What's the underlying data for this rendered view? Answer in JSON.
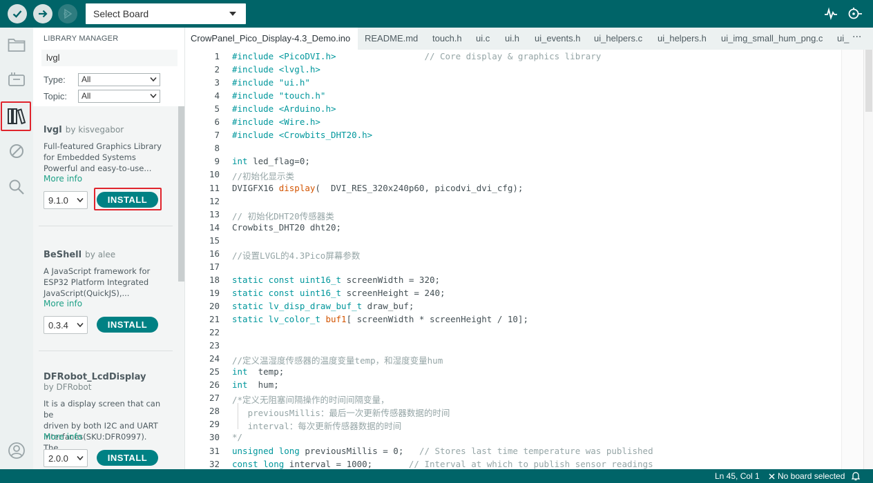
{
  "toolbar": {
    "board_select": "Select Board",
    "icons": [
      "check-icon",
      "arrow-right-icon",
      "debug-icon",
      "chevron-down-icon",
      "serial-plotter-icon",
      "serial-monitor-icon"
    ],
    "accent_color": "#006468"
  },
  "activity": {
    "icons": [
      "folder-icon",
      "board-icon",
      "library-icon",
      "debug-icon",
      "search-icon",
      "account-icon"
    ],
    "selected": "library-icon"
  },
  "library": {
    "title": "LIBRARY MANAGER",
    "search_value": "lvgl",
    "type_label": "Type:",
    "type_value": "All",
    "topic_label": "Topic:",
    "topic_value": "All",
    "items": [
      {
        "name": "lvgl",
        "author": "by kisvegabor",
        "desc": [
          "Full-featured Graphics Library",
          "for Embedded Systems",
          "Powerful and easy-to-use..."
        ],
        "more": "More info",
        "version": "9.1.0",
        "install": "INSTALL"
      },
      {
        "name": "BeShell",
        "author": "by alee",
        "desc": [
          "A JavaScript framework for",
          "ESP32 Platform Integrated",
          "JavaScript(QuickJS),..."
        ],
        "more": "More info",
        "version": "0.3.4",
        "install": "INSTALL"
      },
      {
        "name": "DFRobot_LcdDisplay",
        "author": "by DFRobot",
        "desc": [
          "It is a display screen that can be",
          "driven by both I2C and UART",
          "interfaces(SKU:DFR0997). The..."
        ],
        "more": "More info",
        "version": "2.0.0",
        "install": "INSTALL"
      }
    ]
  },
  "tabs": [
    "CrowPanel_Pico_Display-4.3_Demo.ino",
    "README.md",
    "touch.h",
    "ui.c",
    "ui.h",
    "ui_events.h",
    "ui_helpers.c",
    "ui_helpers.h",
    "ui_img_small_hum_png.c",
    "ui_"
  ],
  "tab_more": "···",
  "code_lines": [
    {
      "n": "1",
      "segs": [
        {
          "t": "#include <PicoDVI.h>",
          "c": "kw"
        },
        {
          "t": "                 // Core display & graphics library",
          "c": "cm"
        }
      ]
    },
    {
      "n": "2",
      "segs": [
        {
          "t": "#include <lvgl.h>",
          "c": "kw"
        }
      ]
    },
    {
      "n": "3",
      "segs": [
        {
          "t": "#include \"ui.h\"",
          "c": "kw"
        }
      ]
    },
    {
      "n": "4",
      "segs": [
        {
          "t": "#include \"touch.h\"",
          "c": "kw"
        }
      ]
    },
    {
      "n": "5",
      "segs": [
        {
          "t": "#include <Arduino.h>",
          "c": "kw"
        }
      ]
    },
    {
      "n": "6",
      "segs": [
        {
          "t": "#include <Wire.h>",
          "c": "kw"
        }
      ]
    },
    {
      "n": "7",
      "segs": [
        {
          "t": "#include <Crowbits_DHT20.h>",
          "c": "kw"
        }
      ]
    },
    {
      "n": "8",
      "segs": []
    },
    {
      "n": "9",
      "segs": [
        {
          "t": "int",
          "c": "kw"
        },
        {
          "t": " led_flag=0;",
          "c": ""
        }
      ]
    },
    {
      "n": "10",
      "segs": [
        {
          "t": "//初始化显示类",
          "c": "cm"
        }
      ]
    },
    {
      "n": "11",
      "segs": [
        {
          "t": "DVIGFX16 ",
          "c": ""
        },
        {
          "t": "display",
          "c": "fn"
        },
        {
          "t": "(  DVI_RES_320x240p60, picodvi_dvi_cfg);",
          "c": ""
        }
      ]
    },
    {
      "n": "12",
      "segs": []
    },
    {
      "n": "13",
      "segs": [
        {
          "t": "// 初始化DHT20传感器类",
          "c": "cm"
        }
      ]
    },
    {
      "n": "14",
      "segs": [
        {
          "t": "Crowbits_DHT20 dht20;",
          "c": ""
        }
      ]
    },
    {
      "n": "15",
      "segs": []
    },
    {
      "n": "16",
      "segs": [
        {
          "t": "//设置LVGL的4.3Pico屏幕参数",
          "c": "cm"
        }
      ]
    },
    {
      "n": "17",
      "segs": []
    },
    {
      "n": "18",
      "segs": [
        {
          "t": "static const uint16_t",
          "c": "kw"
        },
        {
          "t": " screenWidth = 320;",
          "c": ""
        }
      ]
    },
    {
      "n": "19",
      "segs": [
        {
          "t": "static const uint16_t",
          "c": "kw"
        },
        {
          "t": " screenHeight = 240;",
          "c": ""
        }
      ]
    },
    {
      "n": "20",
      "segs": [
        {
          "t": "static lv_disp_draw_buf_t",
          "c": "kw"
        },
        {
          "t": " draw_buf;",
          "c": ""
        }
      ]
    },
    {
      "n": "21",
      "segs": [
        {
          "t": "static lv_color_t ",
          "c": "kw"
        },
        {
          "t": "buf1",
          "c": "fn"
        },
        {
          "t": "[ screenWidth * screenHeight / 10];",
          "c": ""
        }
      ]
    },
    {
      "n": "22",
      "segs": []
    },
    {
      "n": "23",
      "segs": []
    },
    {
      "n": "24",
      "segs": [
        {
          "t": "//定义温湿度传感器的温度变量temp，和湿度变量hum",
          "c": "cm"
        }
      ]
    },
    {
      "n": "25",
      "segs": [
        {
          "t": "int",
          "c": "kw"
        },
        {
          "t": "  temp;",
          "c": ""
        }
      ]
    },
    {
      "n": "26",
      "segs": [
        {
          "t": "int",
          "c": "kw"
        },
        {
          "t": "  hum;",
          "c": ""
        }
      ]
    },
    {
      "n": "27",
      "segs": [
        {
          "t": "/*定义无阻塞间隔操作的时间间隔变量，",
          "c": "cm"
        }
      ]
    },
    {
      "n": "28",
      "segs": [
        {
          "t": "   previousMillis：最后一次更新传感器数据的时间",
          "c": "cm"
        }
      ]
    },
    {
      "n": "29",
      "segs": [
        {
          "t": "   interval：每次更新传感器数据的时间",
          "c": "cm"
        }
      ]
    },
    {
      "n": "30",
      "segs": [
        {
          "t": "*/",
          "c": "cm"
        }
      ]
    },
    {
      "n": "31",
      "segs": [
        {
          "t": "unsigned long",
          "c": "kw"
        },
        {
          "t": " previousMillis = 0;   ",
          "c": ""
        },
        {
          "t": "// Stores last time temperature was published",
          "c": "cm"
        }
      ]
    },
    {
      "n": "32",
      "segs": [
        {
          "t": "const long",
          "c": "kw"
        },
        {
          "t": " interval = 1000;       ",
          "c": ""
        },
        {
          "t": "// Interval at which to publish sensor readings",
          "c": "cm"
        }
      ]
    }
  ],
  "status": {
    "position": "Ln 45, Col 1",
    "board": "No board selected",
    "icons": [
      "close-icon",
      "bell-icon"
    ]
  }
}
